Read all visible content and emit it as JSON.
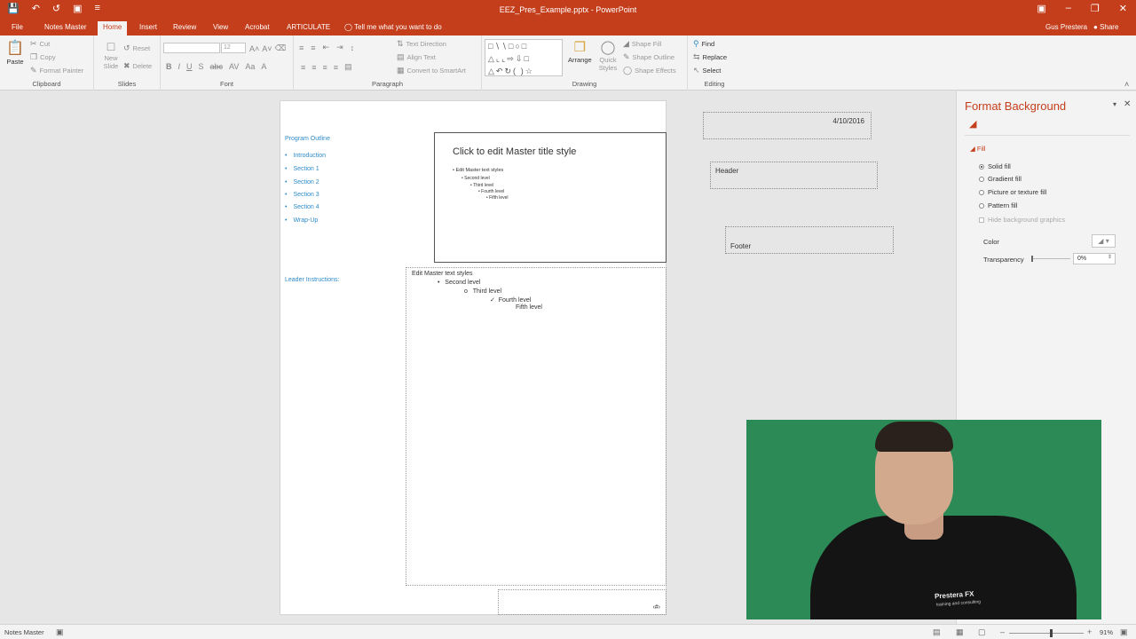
{
  "titlebar": {
    "title": "EEZ_Pres_Example.pptx - PowerPoint",
    "qat_icons": [
      "save-icon",
      "undo-icon",
      "redo-icon",
      "customize-icon"
    ],
    "window_icons": [
      "ribbon-display-icon",
      "minimize-icon",
      "restore-icon",
      "close-icon"
    ]
  },
  "tabs": [
    {
      "label": "File"
    },
    {
      "label": "Notes Master"
    },
    {
      "label": "Home",
      "active": true
    },
    {
      "label": "Insert"
    },
    {
      "label": "Review"
    },
    {
      "label": "View"
    },
    {
      "label": "Acrobat"
    },
    {
      "label": "ARTICULATE"
    }
  ],
  "tell_me": "Tell me what you want to do",
  "user_name": "Gus Prestera",
  "share_label": "Share",
  "ribbon": {
    "clipboard": {
      "paste": "Paste",
      "cut": "Cut",
      "copy": "Copy",
      "format_painter": "Format Painter",
      "label": "Clipboard"
    },
    "slides": {
      "new_slide": "New Slide",
      "reset": "Reset",
      "delete": "Delete",
      "label": "Slides"
    },
    "font": {
      "size": "12",
      "label": "Font"
    },
    "paragraph": {
      "text_direction": "Text Direction",
      "align_text": "Align Text",
      "convert_smartart": "Convert to SmartArt",
      "label": "Paragraph"
    },
    "drawing": {
      "arrange": "Arrange",
      "quick_styles": "Quick Styles",
      "shape_fill": "Shape Fill",
      "shape_outline": "Shape Outline",
      "shape_effects": "Shape Effects",
      "label": "Drawing"
    },
    "editing": {
      "find": "Find",
      "replace": "Replace",
      "select": "Select",
      "label": "Editing"
    }
  },
  "notes_page": {
    "program_outline": "Program Outline",
    "outline_items": [
      "Introduction",
      "Section 1",
      "Section 2",
      "Section 3",
      "Section 4",
      "Wrap-Up"
    ],
    "leader_instructions": "Leader Instructions:",
    "slide_title": "Click to edit Master title style",
    "slide_levels": [
      "Edit Master text styles",
      "Second level",
      "Third level",
      "Fourth level",
      "Fifth level"
    ],
    "notes_levels": [
      "Edit Master text styles",
      "Second level",
      "Third level",
      "Fourth level",
      "Fifth level"
    ],
    "page_number": "‹#›"
  },
  "placeholders": {
    "date": "4/10/2016",
    "header": "Header",
    "footer": "Footer"
  },
  "format_background": {
    "title": "Format Background",
    "fill_heading": "Fill",
    "options": [
      "Solid fill",
      "Gradient fill",
      "Picture or texture fill",
      "Pattern fill"
    ],
    "selected_option": "Solid fill",
    "hide_background": "Hide background graphics",
    "color_label": "Color",
    "transparency_label": "Transparency",
    "transparency_value": "0%"
  },
  "webcam": {
    "shirt_logo": "Prestera FX",
    "shirt_tagline": "training and consulting"
  },
  "statusbar": {
    "view_name": "Notes Master",
    "zoom": "91%"
  },
  "colors": {
    "accent": "#c43e1c",
    "link_blue": "#2e8bc9"
  }
}
